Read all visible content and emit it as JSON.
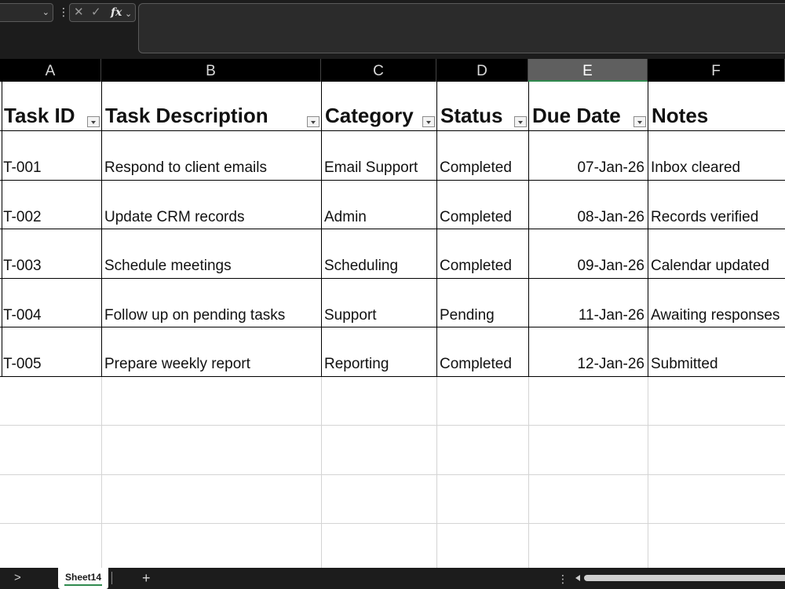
{
  "formula_bar": {
    "name_box_value": "",
    "name_box_chevron": "⌄",
    "dots": "⋮",
    "cancel_glyph": "✕",
    "enter_glyph": "✓",
    "fx_label": "fx",
    "fx_chevron": "⌄",
    "formula_value": ""
  },
  "columns": [
    {
      "letter": "A",
      "selected": false
    },
    {
      "letter": "B",
      "selected": false
    },
    {
      "letter": "C",
      "selected": false
    },
    {
      "letter": "D",
      "selected": false
    },
    {
      "letter": "E",
      "selected": true
    },
    {
      "letter": "F",
      "selected": false
    }
  ],
  "table": {
    "headers": [
      "Task ID",
      "Task Description",
      "Category",
      "Status",
      "Due Date",
      "Notes"
    ],
    "rows": [
      [
        "T-001",
        "Respond to client emails",
        "Email Support",
        "Completed",
        "07-Jan-26",
        "Inbox cleared"
      ],
      [
        "T-002",
        "Update CRM records",
        "Admin",
        "Completed",
        "08-Jan-26",
        "Records verified"
      ],
      [
        "T-003",
        "Schedule meetings",
        "Scheduling",
        "Completed",
        "09-Jan-26",
        "Calendar updated"
      ],
      [
        "T-004",
        "Follow up on pending tasks",
        "Support",
        "Pending",
        "11-Jan-26",
        "Awaiting responses"
      ],
      [
        "T-005",
        "Prepare weekly report",
        "Reporting",
        "Completed",
        "12-Jan-26",
        "Submitted"
      ]
    ]
  },
  "sheet_tabs": {
    "nav_next": ">",
    "active_tab": "Sheet14",
    "add_label": "+",
    "dots": "⋮"
  },
  "colors": {
    "chrome_dark": "#1c1c1c",
    "accent_green": "#2f8a4e",
    "selected_header": "#5f5f5f"
  }
}
